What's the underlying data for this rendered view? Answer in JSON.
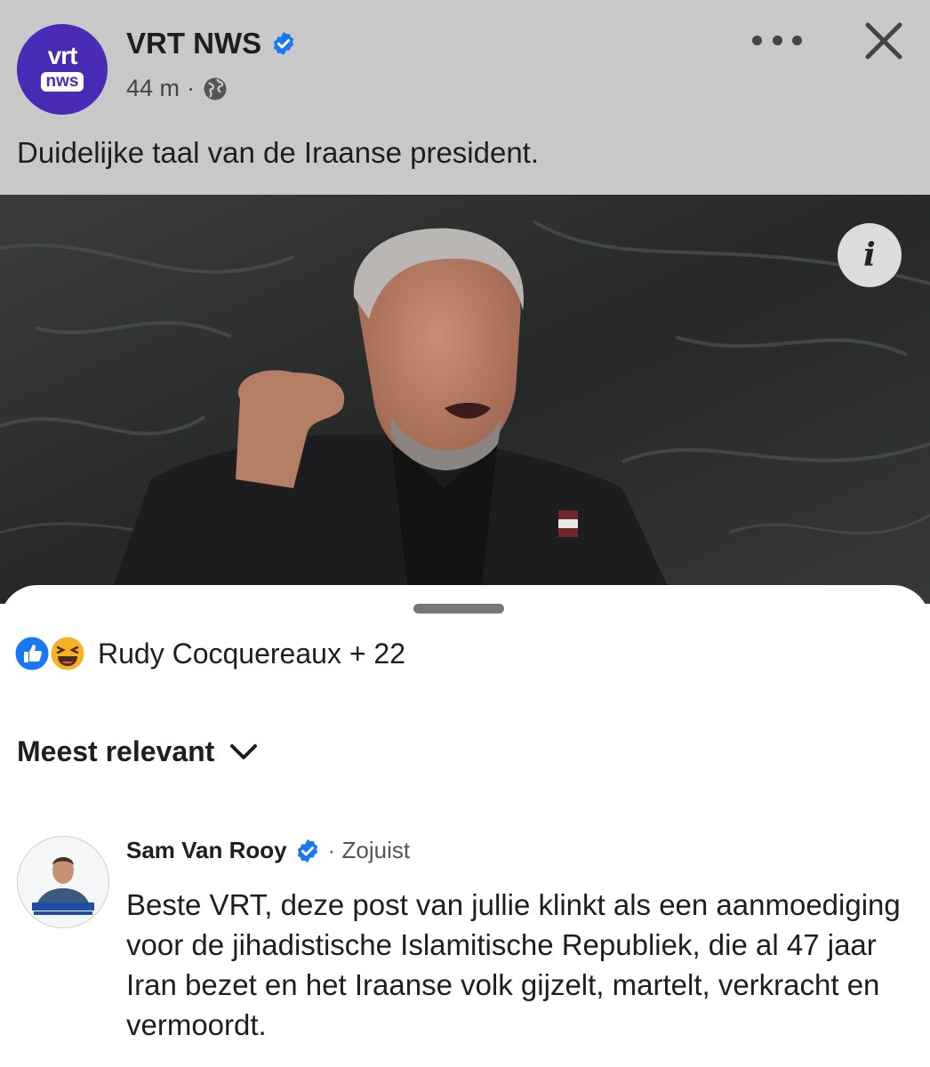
{
  "post": {
    "page_name": "VRT NWS",
    "avatar_top": "vrt",
    "avatar_bottom": "nws",
    "time": "44 m",
    "separator": "·",
    "text": "Duidelijke taal van de Iraanse president."
  },
  "image": {
    "info_label": "i"
  },
  "reactions": {
    "label": "Rudy Cocquereaux + 22"
  },
  "sort": {
    "label": "Meest relevant"
  },
  "comment": {
    "author": "Sam Van Rooy",
    "time": "· Zojuist",
    "text": "Beste VRT, deze post van jullie klinkt als een aanmoediging voor de jihadistische Islamitische Republiek, die al 47 jaar Iran bezet en het Iraanse volk gijzelt, martelt, verkracht en vermoordt."
  },
  "colors": {
    "brand": "#4a2bb5",
    "verified": "#1877f2",
    "header_overlay": "#c8c8c8"
  }
}
